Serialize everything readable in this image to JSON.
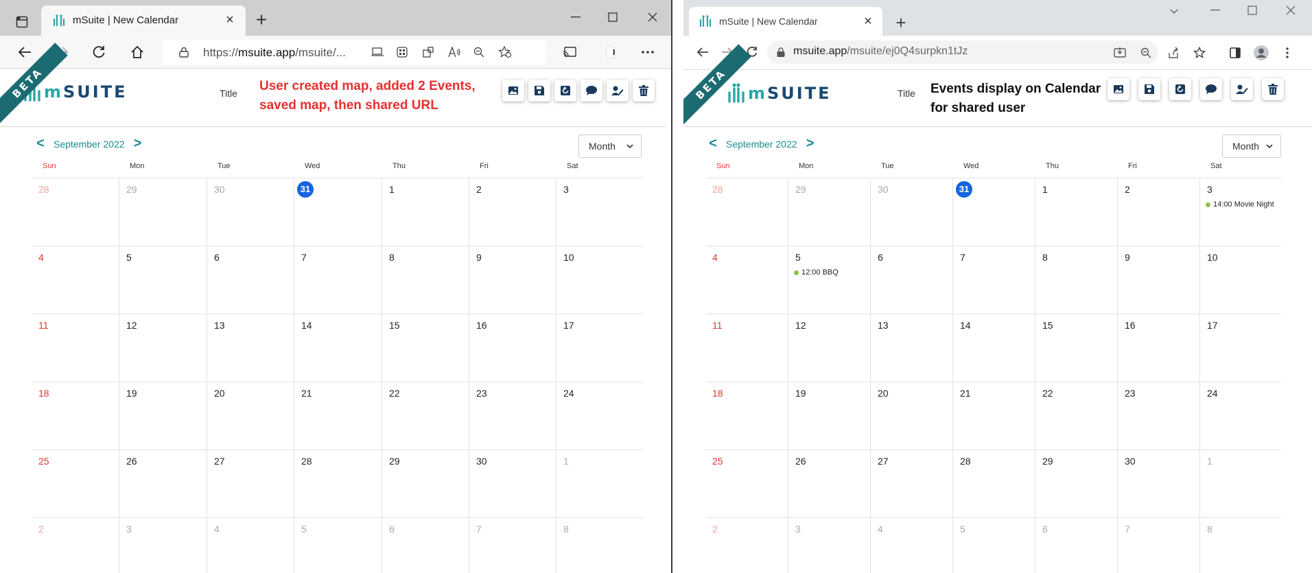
{
  "left": {
    "tab_title": "mSuite | New Calendar",
    "url_prefix": "https://",
    "url_host": "msuite.app",
    "url_rest": "/msuite/...",
    "app": {
      "badge": "BETA",
      "logo_m": "m",
      "logo_text": "SUITE",
      "title_label": "Title",
      "title_line1": "User created map, added 2 Events,",
      "title_line2": "saved map, then shared URL",
      "title_color": "#e53030",
      "month_label": "September 2022",
      "prev": "<",
      "next": ">",
      "view_select": "Month"
    }
  },
  "right": {
    "tab_title": "mSuite | New Calendar",
    "url_host": "msuite.app",
    "url_rest": "/msuite/ej0Q4surpkn1tJz",
    "app": {
      "badge": "BETA",
      "logo_m": "m",
      "logo_text": "SUITE",
      "title_label": "Title",
      "title_line1": "Events display on Calendar",
      "title_line2": "for shared user",
      "title_color": "#111111",
      "month_label": "September 2022",
      "prev": "<",
      "next": ">",
      "view_select": "Month"
    }
  },
  "calendar": {
    "weekdays": [
      "Sun",
      "Mon",
      "Tue",
      "Wed",
      "Thu",
      "Fri",
      "Sat"
    ],
    "weeks": [
      [
        "28",
        "29",
        "30",
        "31",
        "1",
        "2",
        "3"
      ],
      [
        "4",
        "5",
        "6",
        "7",
        "8",
        "9",
        "10"
      ],
      [
        "11",
        "12",
        "13",
        "14",
        "15",
        "16",
        "17"
      ],
      [
        "18",
        "19",
        "20",
        "21",
        "22",
        "23",
        "24"
      ],
      [
        "25",
        "26",
        "27",
        "28",
        "29",
        "30",
        "1"
      ],
      [
        "2",
        "3",
        "4",
        "5",
        "6",
        "7",
        "8"
      ]
    ],
    "today": "31"
  },
  "events": [
    {
      "week": 0,
      "day": 6,
      "label": "14:00 Movie Night",
      "color": "#8bc34a"
    },
    {
      "week": 1,
      "day": 1,
      "label": "12:00 BBQ",
      "color": "#8bc34a"
    }
  ],
  "colors": {
    "accent_teal": "#1d8a8f",
    "brand_navy": "#1a4a72",
    "today_blue": "#1565e0",
    "sunday_red": "#e0352c"
  },
  "action_icons": [
    "image-icon",
    "save-icon",
    "history-icon",
    "chat-icon",
    "share-user-icon",
    "trash-icon"
  ]
}
